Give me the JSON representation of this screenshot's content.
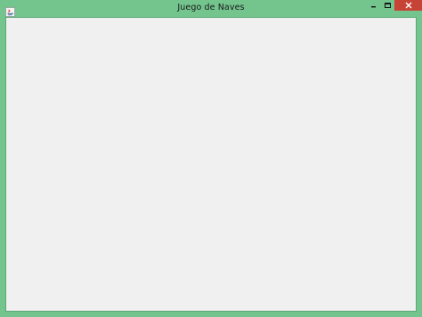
{
  "window": {
    "title": "Juego de Naves",
    "accent_color": "#73c48d",
    "close_color": "#c74336"
  },
  "titlebar": {
    "app_icon": "java-icon",
    "controls": {
      "minimize_icon": "minimize-icon",
      "maximize_icon": "maximize-icon",
      "close_icon": "close-icon"
    }
  },
  "content": {
    "background": "#f0f0f0"
  }
}
